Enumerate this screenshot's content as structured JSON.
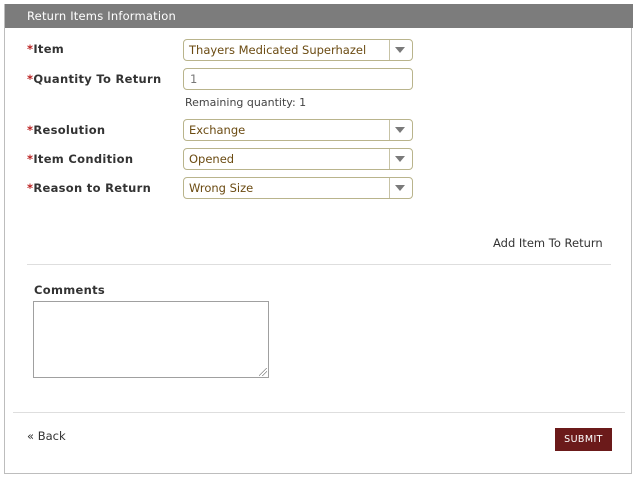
{
  "section": {
    "title": "Return Items Information"
  },
  "form": {
    "required_mark": "*",
    "item": {
      "label": "Item",
      "value": "Thayers Medicated Superhazel"
    },
    "quantity": {
      "label": "Quantity To Return",
      "value": "1",
      "hint": "Remaining quantity: 1"
    },
    "resolution": {
      "label": "Resolution",
      "value": "Exchange"
    },
    "condition": {
      "label": "Item Condition",
      "value": "Opened"
    },
    "reason": {
      "label": "Reason to Return",
      "value": "Wrong Size"
    },
    "add_item_link": "Add Item To Return"
  },
  "comments": {
    "label": "Comments",
    "value": ""
  },
  "footer": {
    "back_link": "« Back",
    "submit_label": "SUBMIT"
  },
  "colors": {
    "header_bg": "#7c7c7c",
    "submit_bg": "#6b1a1a",
    "field_border": "#b9b48c",
    "required": "#bb2222"
  }
}
